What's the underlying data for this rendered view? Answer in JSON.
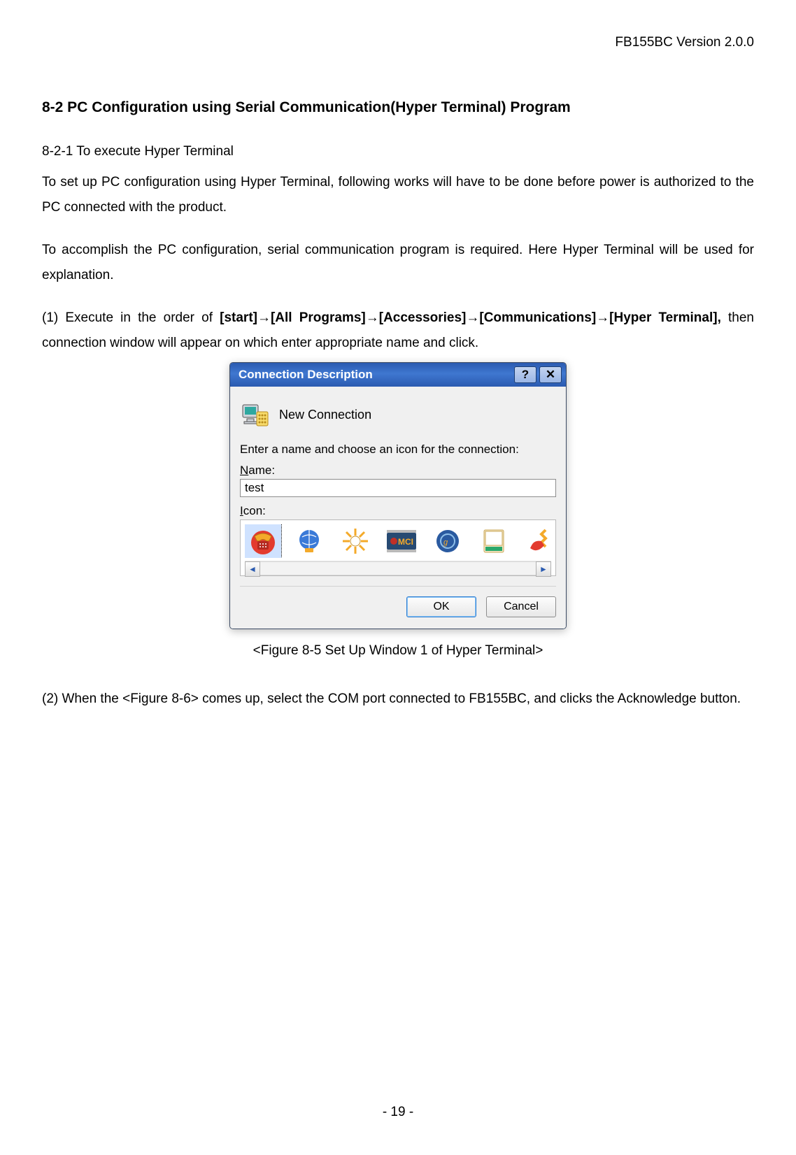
{
  "header": {
    "version": "FB155BC Version 2.0.0"
  },
  "section": {
    "title": "8-2 PC Configuration using Serial Communication(Hyper Terminal) Program",
    "subsection": "8-2-1 To execute Hyper Terminal",
    "para1": "To set up PC configuration using Hyper Terminal, following works will have to be done before power is authorized to the PC connected with the product.",
    "para2": "To accomplish the PC configuration, serial communication program is required. Here Hyper Terminal will be used for explanation.",
    "step1_prefix": "(1) Execute in the order of ",
    "step1_bold": "[start]→[All Programs]→[Accessories]→[Communications]→[Hyper Terminal],",
    "step1_suffix": " then connection window will appear on which enter appropriate name and click.",
    "figure_caption": "<Figure 8-5 Set Up Window 1 of Hyper Terminal>",
    "step2": "(2) When the <Figure 8-6> comes up, select the COM port connected to FB155BC, and clicks the Acknowledge button."
  },
  "dialog": {
    "title": "Connection Description",
    "newconn_label": "New Connection",
    "prompt": "Enter a name and choose an icon for the connection:",
    "name_label_prefix": "N",
    "name_label_rest": "ame:",
    "name_value": "test",
    "icon_label_prefix": "I",
    "icon_label_rest": "con:",
    "ok_label": "OK",
    "cancel_label": "Cancel"
  },
  "footer": {
    "page": "- 19 -"
  },
  "icons": {
    "picker": [
      "phone-icon",
      "globe-atlas-icon",
      "sunburst-icon",
      "mci-chip-icon",
      "dial-globe-icon",
      "satellite-dish-icon",
      "lightning-phone-icon"
    ]
  }
}
